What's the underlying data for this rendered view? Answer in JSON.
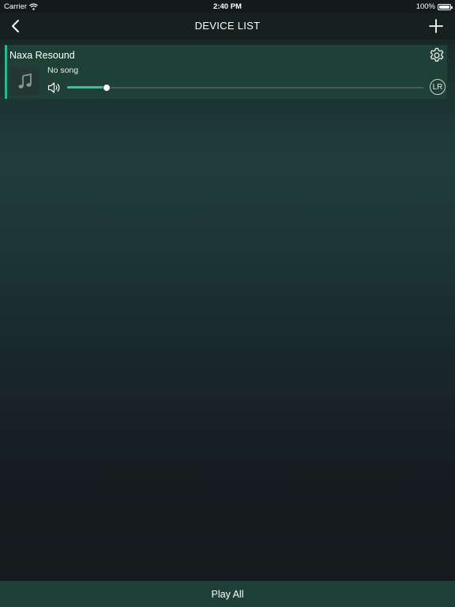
{
  "status_bar": {
    "carrier": "Carrier",
    "time": "2:40 PM",
    "battery": "100%",
    "icons": [
      "wifi-icon",
      "battery-icon"
    ]
  },
  "nav": {
    "title": "DEVICE LIST",
    "icons": [
      "back-chevron-icon",
      "plus-icon"
    ]
  },
  "devices": [
    {
      "name": "Naxa Resound",
      "song": "No song",
      "volume_fraction": 0.11,
      "channel_label": "LR",
      "icons": [
        "gear-icon",
        "music-note-icon",
        "speaker-volume-icon"
      ]
    }
  ],
  "footer": {
    "play_all_label": "Play All"
  },
  "colors": {
    "accent": "#2ec59a",
    "card_background": "#1f4036",
    "bar_background": "#15201f"
  }
}
